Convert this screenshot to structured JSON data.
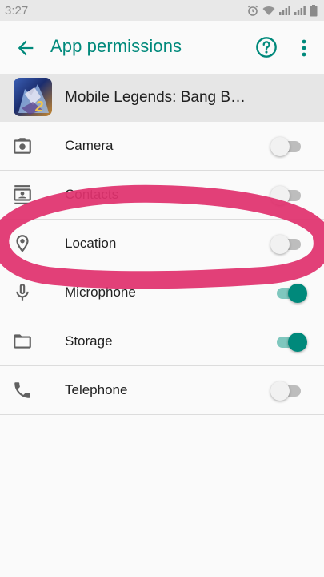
{
  "status_bar": {
    "time": "3:27"
  },
  "app_bar": {
    "title": "App permissions"
  },
  "app": {
    "name": "Mobile Legends: Bang B…",
    "badge": "2"
  },
  "permissions": [
    {
      "label": "Camera",
      "icon": "camera-icon",
      "enabled": false
    },
    {
      "label": "Contacts",
      "icon": "contacts-icon",
      "enabled": false
    },
    {
      "label": "Location",
      "icon": "location-icon",
      "enabled": false
    },
    {
      "label": "Microphone",
      "icon": "microphone-icon",
      "enabled": true
    },
    {
      "label": "Storage",
      "icon": "folder-icon",
      "enabled": true
    },
    {
      "label": "Telephone",
      "icon": "phone-icon",
      "enabled": false
    }
  ],
  "colors": {
    "accent": "#00897b",
    "annotation": "#e0326e"
  }
}
